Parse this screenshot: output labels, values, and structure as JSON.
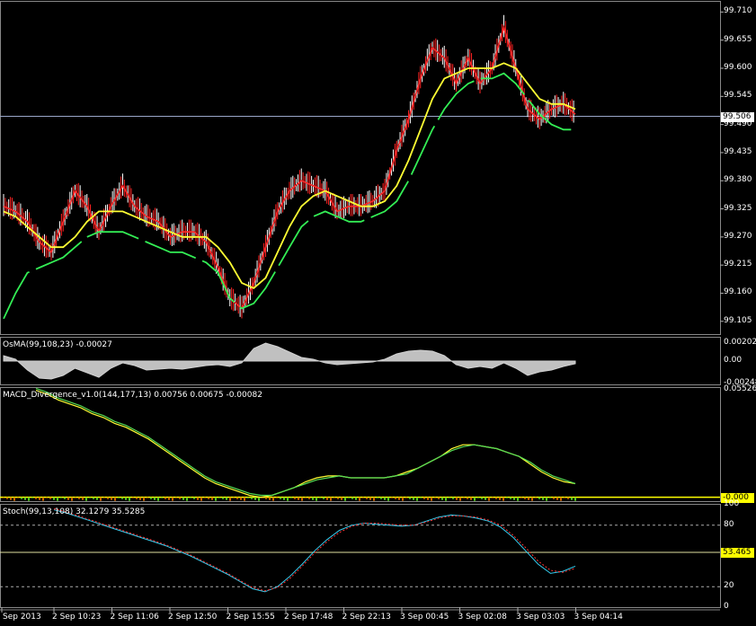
{
  "chart_data": [
    {
      "type": "line",
      "pane": "price",
      "ylim": [
        99.08,
        99.73
      ],
      "y_ticks": [
        "99.710",
        "99.655",
        "99.600",
        "99.545",
        "99.490",
        "99.435",
        "99.380",
        "99.325",
        "99.270",
        "99.215",
        "99.160",
        "99.105"
      ],
      "current_price_label": "99.506",
      "current_price": 99.506,
      "series": [
        {
          "role": "close",
          "color": "#ff2a2a",
          "values": [
            99.33,
            99.32,
            99.3,
            99.26,
            99.24,
            99.3,
            99.36,
            99.33,
            99.28,
            99.33,
            99.37,
            99.33,
            99.31,
            99.3,
            99.27,
            99.28,
            99.28,
            99.26,
            99.21,
            99.15,
            99.13,
            99.18,
            99.25,
            99.32,
            99.36,
            99.38,
            99.37,
            99.36,
            99.32,
            99.33,
            99.33,
            99.34,
            99.36,
            99.44,
            99.5,
            99.58,
            99.64,
            99.62,
            99.57,
            99.62,
            99.57,
            99.6,
            99.68,
            99.6,
            99.52,
            99.5,
            99.52,
            99.53,
            99.51
          ]
        },
        {
          "role": "moving-average",
          "color": "#ffff33",
          "values": [
            99.32,
            99.31,
            99.29,
            99.27,
            99.25,
            99.25,
            99.27,
            99.3,
            99.32,
            99.32,
            99.32,
            99.31,
            99.3,
            99.29,
            99.28,
            99.27,
            99.27,
            99.27,
            99.25,
            99.22,
            99.18,
            99.17,
            99.19,
            99.24,
            99.29,
            99.33,
            99.35,
            99.36,
            99.35,
            99.34,
            99.33,
            99.33,
            99.34,
            99.37,
            99.42,
            99.48,
            99.54,
            99.58,
            99.59,
            99.6,
            99.6,
            99.6,
            99.61,
            99.6,
            99.57,
            99.54,
            99.53,
            99.53,
            99.52
          ]
        },
        {
          "role": "envelope",
          "color": "#33ee55",
          "values": [
            99.11,
            99.16,
            99.2,
            99.21,
            99.22,
            99.23,
            99.25,
            99.27,
            99.28,
            99.28,
            99.28,
            99.27,
            99.26,
            99.25,
            99.24,
            99.24,
            99.23,
            99.22,
            99.2,
            99.15,
            99.13,
            99.14,
            99.17,
            99.21,
            99.25,
            99.29,
            99.31,
            99.32,
            99.31,
            99.3,
            99.3,
            99.31,
            99.32,
            99.34,
            99.38,
            99.43,
            99.48,
            99.52,
            99.55,
            99.57,
            99.58,
            99.58,
            99.59,
            99.57,
            99.54,
            99.51,
            99.49,
            99.48,
            99.48
          ]
        }
      ]
    },
    {
      "type": "area",
      "pane": "osma",
      "label": "OsMA(99,108,23) -0.00027",
      "ylim": [
        -0.0026,
        0.0026
      ],
      "y_ticks": [
        "0.00202",
        "0.00",
        "-0.00248"
      ],
      "y_tick_values": [
        0.00202,
        0,
        -0.00248
      ],
      "values": [
        0.0006,
        0.0002,
        -0.001,
        -0.0019,
        -0.002,
        -0.0016,
        -0.0008,
        -0.0013,
        -0.0018,
        -0.0008,
        -0.0002,
        -0.0005,
        -0.001,
        -0.0009,
        -0.0008,
        -0.0009,
        -0.0007,
        -0.0005,
        -0.0004,
        -0.0006,
        -0.0002,
        0.0014,
        0.002,
        0.0016,
        0.001,
        0.0004,
        0.0002,
        -0.0002,
        -0.0004,
        -0.0003,
        -0.0002,
        -0.0001,
        0.0002,
        0.0008,
        0.0011,
        0.0012,
        0.0011,
        0.0006,
        -0.0004,
        -0.0008,
        -0.0006,
        -0.0008,
        -0.0002,
        -0.0008,
        -0.0016,
        -0.0012,
        -0.001,
        -0.0006,
        -0.0003
      ]
    },
    {
      "type": "line",
      "pane": "macd",
      "label": "MACD_Divergence_v1.0(144,177,13) 0.00756 0.00675 -0.00082",
      "ylim": [
        -0.002,
        0.0562
      ],
      "y_ticks": [
        "0.05526"
      ],
      "y_tick_values": [
        0.05526
      ],
      "zero_label": "-0.000",
      "series": [
        {
          "role": "main",
          "color": "#ffff33",
          "values": [
            0.055,
            0.053,
            0.05,
            0.048,
            0.046,
            0.043,
            0.041,
            0.038,
            0.036,
            0.033,
            0.03,
            0.026,
            0.022,
            0.018,
            0.014,
            0.01,
            0.007,
            0.005,
            0.003,
            0.001,
            0.0,
            0.001,
            0.003,
            0.005,
            0.008,
            0.01,
            0.011,
            0.011,
            0.01,
            0.01,
            0.01,
            0.01,
            0.011,
            0.013,
            0.015,
            0.018,
            0.021,
            0.025,
            0.027,
            0.027,
            0.026,
            0.025,
            0.023,
            0.021,
            0.017,
            0.013,
            0.01,
            0.008,
            0.007
          ]
        },
        {
          "role": "signal",
          "color": "#55dd55",
          "values": [
            0.056,
            0.054,
            0.051,
            0.049,
            0.047,
            0.044,
            0.042,
            0.039,
            0.037,
            0.034,
            0.031,
            0.027,
            0.023,
            0.019,
            0.015,
            0.011,
            0.008,
            0.006,
            0.004,
            0.002,
            0.001,
            0.001,
            0.003,
            0.005,
            0.007,
            0.009,
            0.01,
            0.011,
            0.01,
            0.01,
            0.01,
            0.01,
            0.011,
            0.012,
            0.015,
            0.018,
            0.021,
            0.024,
            0.026,
            0.027,
            0.026,
            0.025,
            0.023,
            0.021,
            0.018,
            0.014,
            0.011,
            0.009,
            0.007
          ]
        }
      ]
    },
    {
      "type": "line",
      "pane": "stoch",
      "label": "Stoch(99,13,108) 32.1279 35.5285",
      "ylim": [
        0,
        100
      ],
      "y_ticks": [
        "100",
        "80",
        "20",
        "0"
      ],
      "y_tick_values": [
        100,
        80,
        20,
        0
      ],
      "level_label": "53.465",
      "level_value": 53.465,
      "series": [
        {
          "role": "main",
          "color": "#33ccee",
          "values": [
            95,
            92,
            88,
            84,
            80,
            76,
            72,
            68,
            64,
            60,
            55,
            50,
            44,
            38,
            32,
            25,
            18,
            15,
            20,
            30,
            42,
            55,
            66,
            75,
            80,
            82,
            81,
            80,
            79,
            80,
            84,
            88,
            90,
            89,
            87,
            84,
            78,
            68,
            55,
            42,
            33,
            35,
            40
          ]
        },
        {
          "role": "signal",
          "color": "#ff3333",
          "values": [
            96,
            93,
            89,
            85,
            81,
            77,
            73,
            69,
            65,
            61,
            56,
            51,
            45,
            39,
            33,
            26,
            19,
            16,
            19,
            28,
            40,
            53,
            64,
            73,
            79,
            82,
            82,
            81,
            80,
            80,
            83,
            87,
            89,
            89,
            88,
            85,
            80,
            70,
            58,
            45,
            36,
            34,
            38
          ]
        }
      ]
    }
  ],
  "x_axis": {
    "labels": [
      "Sep 2013",
      "2 Sep 10:23",
      "2 Sep 11:06",
      "2 Sep 12:50",
      "2 Sep 15:55",
      "2 Sep 17:48",
      "2 Sep 22:13",
      "3 Sep 00:45",
      "3 Sep 02:08",
      "3 Sep 03:03",
      "3 Sep 04:14"
    ]
  }
}
